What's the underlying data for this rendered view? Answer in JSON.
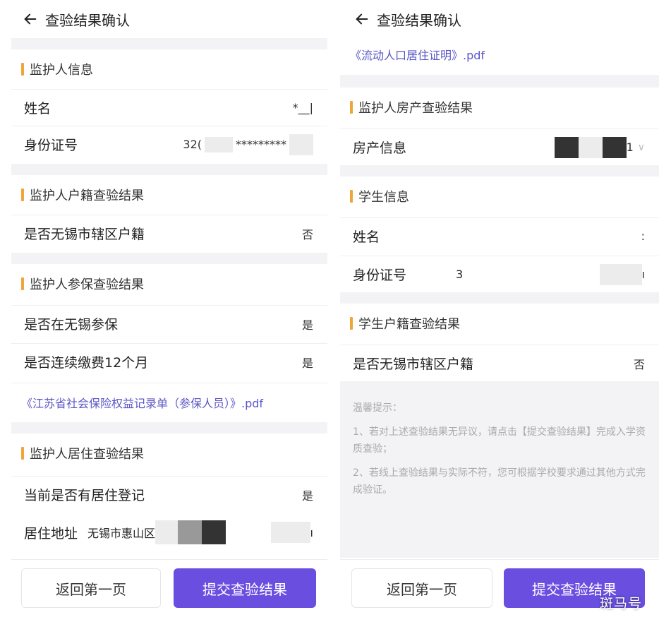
{
  "left": {
    "title": "查验结果确认",
    "guardian_info": {
      "heading": "监护人信息",
      "name_label": "姓名",
      "name_value": "*__|",
      "id_label": "身份证号",
      "id_value_prefix": "32(",
      "id_value_mask": "*********"
    },
    "household": {
      "heading": "监护人户籍查验结果",
      "question": "是否无锡市辖区户籍",
      "answer": "否"
    },
    "insurance": {
      "heading": "监护人参保查验结果",
      "q1": "是否在无锡参保",
      "a1": "是",
      "q2": "是否连续缴费12个月",
      "a2": "是",
      "file_link": "《江苏省社会保险权益记录单（参保人员）》.pdf"
    },
    "residence": {
      "heading": "监护人居住查验结果",
      "q1": "当前是否有居住登记",
      "a1": "是",
      "address_label": "居住地址",
      "address_value": "无锡市惠山区",
      "address_tail": "ı"
    },
    "buttons": {
      "back": "返回第一页",
      "submit": "提交查验结果"
    }
  },
  "right": {
    "title": "查验结果确认",
    "file_link": "《流动人口居住证明》.pdf",
    "property": {
      "heading": "监护人房产查验结果",
      "label": "房产信息",
      "value_tail": "1"
    },
    "student_info": {
      "heading": "学生信息",
      "name_label": "姓名",
      "name_value": ":",
      "id_label": "身份证号",
      "id_value": "3",
      "id_tail": "ı"
    },
    "student_household": {
      "heading": "学生户籍查验结果",
      "question": "是否无锡市辖区户籍",
      "answer": "否"
    },
    "tips": {
      "title": "温馨提示：",
      "tip1": "1、若对上述查验结果无异议，请点击【提交查验结果】完成入学资质查验；",
      "tip2": "2、若线上查验结果与实际不符，您可根据学校要求通过其他方式完成验证。"
    },
    "buttons": {
      "back": "返回第一页",
      "submit": "提交查验结果"
    }
  },
  "watermark": "斑马号",
  "icons": {
    "back": "arrow-left-icon",
    "chevron": "chevron-down-icon"
  },
  "colors": {
    "accent_bar": "#f0a53b",
    "primary_button": "#6a4ee0",
    "link": "#5a56c6",
    "section_gap": "#f3f3f5"
  }
}
